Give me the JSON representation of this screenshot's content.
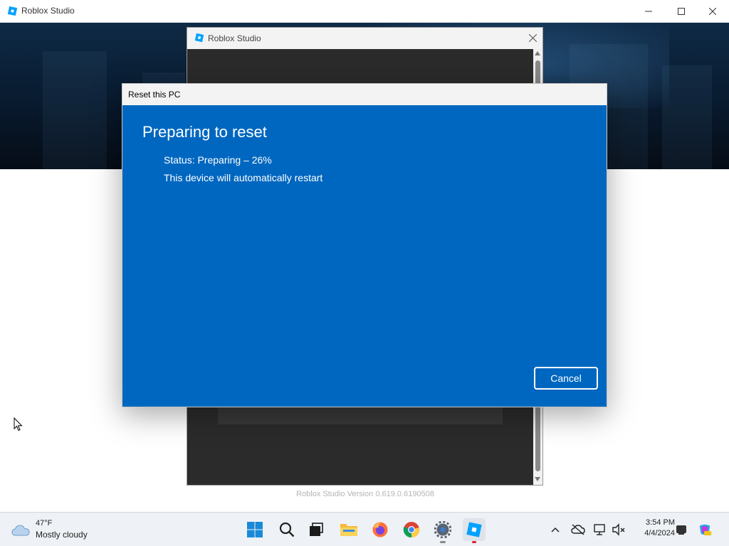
{
  "main_window": {
    "title": "Roblox Studio",
    "version_text": "Roblox Studio Version 0.619.0.6190508"
  },
  "splash_window": {
    "title": "Roblox Studio"
  },
  "reset_dialog": {
    "title": "Reset this PC",
    "heading": "Preparing to reset",
    "status": "Status: Preparing – 26%",
    "progress_percent": 26,
    "restart_notice": "This device will automatically restart",
    "cancel_label": "Cancel",
    "background_color": "#0067c0"
  },
  "taskbar": {
    "weather": {
      "temperature": "47°F",
      "condition": "Mostly cloudy",
      "icon": "cloud-icon"
    },
    "pinned_apps": [
      {
        "name": "start",
        "icon": "windows-logo-icon"
      },
      {
        "name": "search",
        "icon": "search-icon"
      },
      {
        "name": "task-view",
        "icon": "task-view-icon"
      },
      {
        "name": "file-explorer",
        "icon": "folder-icon"
      },
      {
        "name": "firefox",
        "icon": "firefox-icon"
      },
      {
        "name": "chrome",
        "icon": "chrome-icon"
      },
      {
        "name": "settings",
        "icon": "gear-icon"
      },
      {
        "name": "roblox-studio",
        "icon": "roblox-studio-icon"
      }
    ],
    "tray": {
      "time": "3:54 PM",
      "date": "4/4/2024"
    }
  }
}
